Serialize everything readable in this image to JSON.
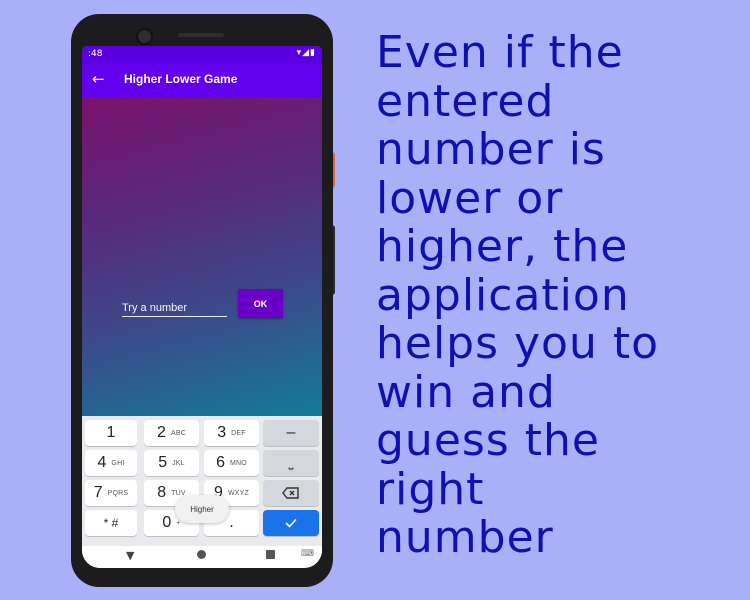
{
  "status_bar": {
    "time": ":48",
    "icons": "▾◢▮"
  },
  "app_bar": {
    "back_icon": "arrow-left-icon",
    "title": "Higher Lower Game"
  },
  "content": {
    "gradient": [
      "#7a126c",
      "#137b9a"
    ],
    "input": {
      "placeholder": "Try a number",
      "value": ""
    },
    "ok_label": "OK",
    "accent": "#6200ee"
  },
  "keyboard": {
    "keys": [
      {
        "num": "1",
        "sub": ""
      },
      {
        "num": "2",
        "sub": "ABC"
      },
      {
        "num": "3",
        "sub": "DEF"
      },
      {
        "num": "4",
        "sub": "GHI"
      },
      {
        "num": "5",
        "sub": "JKL"
      },
      {
        "num": "6",
        "sub": "MNO"
      },
      {
        "num": "7",
        "sub": "PQRS"
      },
      {
        "num": "8",
        "sub": "TUV"
      },
      {
        "num": "9",
        "sub": "WXYZ"
      },
      {
        "num": "* #",
        "sub": ""
      },
      {
        "num": "0",
        "sub": "+"
      },
      {
        "num": ".",
        "sub": ""
      }
    ],
    "func_keys": {
      "minus": "–",
      "space": "⎵",
      "delete_icon": "backspace-icon",
      "enter_icon": "check-icon"
    }
  },
  "toast": "Higher",
  "caption_lines": [
    "Even if the",
    "entered",
    "number is",
    "lower or",
    "higher, the",
    "application",
    "helps you to",
    "win and",
    "guess the",
    "right",
    "number"
  ]
}
